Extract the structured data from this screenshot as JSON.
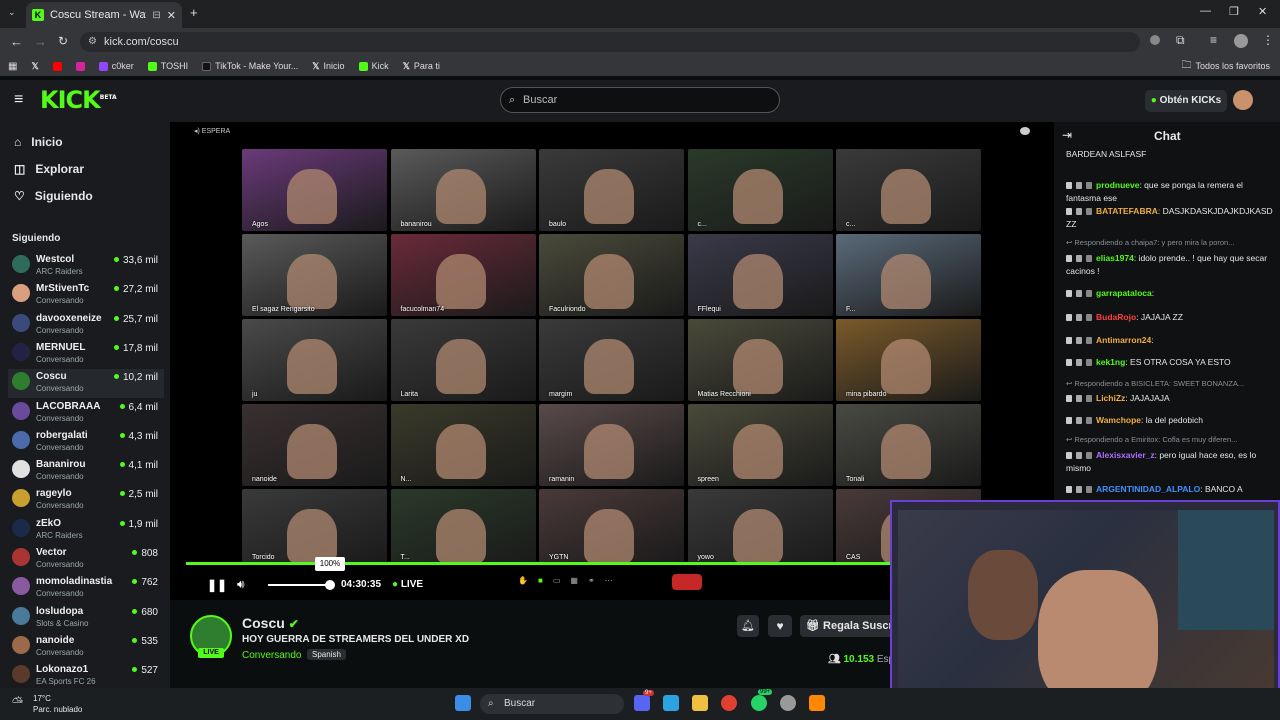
{
  "browser": {
    "tab_title": "Coscu Stream - Watch Live",
    "url": "kick.com/coscu",
    "bookmarks": [
      "c0ker",
      "TOSHI",
      "TikTok - Make Your...",
      "Inicio",
      "Kick",
      "Para ti"
    ],
    "bookmarks_right": "Todos los favoritos"
  },
  "header": {
    "logo": "KICK",
    "logo_tag": "BETA",
    "search_placeholder": "Buscar",
    "kicks_button": "Obtén KICKs"
  },
  "nav": {
    "inicio": "Inicio",
    "explorar": "Explorar",
    "siguiendo": "Siguiendo"
  },
  "following_title": "Siguiendo",
  "following": [
    {
      "name": "Westcol",
      "category": "ARC Raiders",
      "count": "33,6 mil",
      "color": "#2e6b5a"
    },
    {
      "name": "MrStivenTc",
      "category": "Conversando",
      "count": "27,2 mil",
      "color": "#d8a080"
    },
    {
      "name": "davooxeneize",
      "category": "Conversando",
      "count": "25,7 mil",
      "color": "#3a4a7a"
    },
    {
      "name": "MERNUEL",
      "category": "Conversando",
      "count": "17,8 mil",
      "color": "#222244"
    },
    {
      "name": "Coscu",
      "category": "Conversando",
      "count": "10,2 mil",
      "color": "#2f7d2f"
    },
    {
      "name": "LACOBRAAA",
      "category": "Conversando",
      "count": "6,4 mil",
      "color": "#6a4a9a"
    },
    {
      "name": "robergalati",
      "category": "Conversando",
      "count": "4,3 mil",
      "color": "#4a6aaa"
    },
    {
      "name": "Bananirou",
      "category": "Conversando",
      "count": "4,1 mil",
      "color": "#e0e0e0"
    },
    {
      "name": "rageylo",
      "category": "Conversando",
      "count": "2,5 mil",
      "color": "#c8a030"
    },
    {
      "name": "zEkO",
      "category": "ARC Raiders",
      "count": "1,9 mil",
      "color": "#1a2a4a"
    },
    {
      "name": "Vector",
      "category": "Conversando",
      "count": "808",
      "color": "#aa3333"
    },
    {
      "name": "momoladinastia",
      "category": "Conversando",
      "count": "762",
      "color": "#8a5aa0"
    },
    {
      "name": "losludopa",
      "category": "Slots & Casino",
      "count": "680",
      "color": "#4a7a9a"
    },
    {
      "name": "nanoide",
      "category": "Conversando",
      "count": "535",
      "color": "#9a6a4a"
    },
    {
      "name": "Lokonazo1",
      "category": "EA Sports FC 26",
      "count": "527",
      "color": "#5a3a2a"
    }
  ],
  "video": {
    "waiting_label": "ESPERA",
    "tiles": [
      "Agos",
      "bananirou",
      "baulo",
      "c...",
      "c...",
      "El sagaz Rengarsito",
      "facucolman74",
      "Faculriondo",
      "FFlequi",
      "F...",
      "ju",
      "Larita",
      "margim",
      "Matias Recchioni",
      "mina pibardo",
      "nanoide",
      "N...",
      "ramanin",
      "spreen",
      "Tonali",
      "Torcido",
      "T...",
      "YGTN",
      "yowo",
      "CAS"
    ],
    "volume_tooltip": "100%",
    "volume_level": 1.0,
    "time": "04:30:35",
    "live_label": "LIVE"
  },
  "stream": {
    "name": "Coscu",
    "title": "HOY GUERRA DE STREAMERS DEL UNDER XD",
    "category": "Conversando",
    "language": "Spanish",
    "live_badge": "LIVE",
    "gift_button": "Regala Suscri",
    "viewers": "10.153",
    "viewers_suffix": "Esp"
  },
  "chat": {
    "title": "Chat",
    "messages": [
      {
        "user": "",
        "text": "BARDEAN ASLFASF",
        "color": "#e6e6e6"
      },
      {
        "user": "prodnueve",
        "text": ": que se ponga la remera el fantasma ese",
        "color": "#53fc18"
      },
      {
        "user": "BATATEFABRA",
        "text": ": DASJKDASKJDAJKDJKASD ZZ",
        "color": "#f0b040"
      },
      {
        "reply": "Respondiendo a chaipa7: y pero mira la poron..."
      },
      {
        "user": "elias1974",
        "text": ": idolo prende.. ! que hay que secar cacinos !",
        "color": "#53fc18"
      },
      {
        "user": "garrapataloca",
        "text": ":",
        "color": "#53fc18"
      },
      {
        "user": "BudaRojo",
        "text": ": JAJAJA ZZ",
        "color": "#ff4040"
      },
      {
        "user": "Antimarron24",
        "text": ":",
        "color": "#f0b040"
      },
      {
        "user": "kek1ng",
        "text": ": ES OTRA COSA YA ESTO",
        "color": "#53fc18"
      },
      {
        "reply": "Respondiendo a BISICLETA: SWEET BONANZA..."
      },
      {
        "user": "LichiZz",
        "text": ": JAJAJAJA",
        "color": "#f0b040"
      },
      {
        "user": "Wamchope",
        "text": ": la del pedobich",
        "color": "#f0b040"
      },
      {
        "reply": "Respondiendo a Emiritox: Cofla es muy diferen..."
      },
      {
        "user": "Alexisxavier_z",
        "text": ": pero igual hace eso, es lo mismo",
        "color": "#b070ff"
      },
      {
        "user": "ARGENTINIDAD_ALPALO",
        "text": ": BANCO A",
        "color": "#4090ff"
      }
    ]
  },
  "taskbar": {
    "weather_temp": "17°C",
    "weather_desc": "Parc. nublado",
    "search": "Buscar",
    "badge1": "9+",
    "badge2": "99+"
  }
}
